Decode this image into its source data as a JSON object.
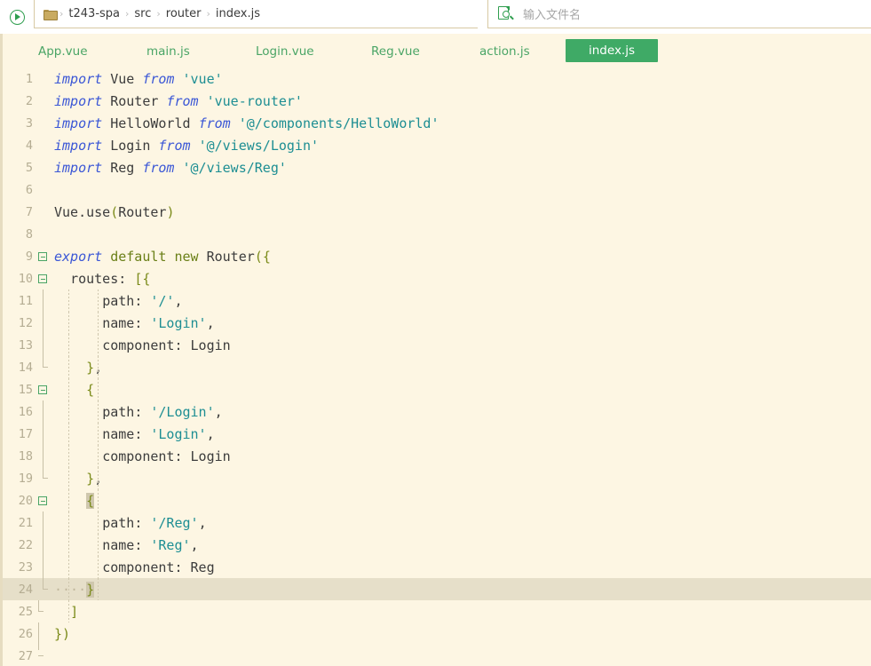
{
  "toolbar": {
    "run_icon": "play-circle-icon",
    "folder_icon": "folder-icon",
    "breadcrumb": [
      "t243-spa",
      "src",
      "router",
      "index.js"
    ],
    "breadcrumb_separator": "›",
    "search": {
      "icon": "find-file-icon",
      "placeholder": "输入文件名"
    }
  },
  "tabs": [
    {
      "label": "App.vue",
      "active": false
    },
    {
      "label": "main.js",
      "active": false
    },
    {
      "label": "Login.vue",
      "active": false
    },
    {
      "label": "Reg.vue",
      "active": false
    },
    {
      "label": "action.js",
      "active": false
    },
    {
      "label": "index.js",
      "active": true
    }
  ],
  "editor": {
    "file": "index.js",
    "current_line": 24,
    "total_lines": 27,
    "colors": {
      "background": "#fdf6e3",
      "current_line": "#e6dfc9",
      "line_number": "#b5ad93",
      "keyword": "#3b57d6",
      "keyword2": "#6a7f17",
      "identifier": "#3c3c3c",
      "string": "#1d8e93",
      "bracket": "#7a8a18",
      "accent_green": "#3faa66"
    },
    "lines": [
      {
        "n": 1,
        "text": "import Vue from 'vue'"
      },
      {
        "n": 2,
        "text": "import Router from 'vue-router'"
      },
      {
        "n": 3,
        "text": "import HelloWorld from '@/components/HelloWorld'"
      },
      {
        "n": 4,
        "text": "import Login from '@/views/Login'"
      },
      {
        "n": 5,
        "text": "import Reg from '@/views/Reg'"
      },
      {
        "n": 6,
        "text": ""
      },
      {
        "n": 7,
        "text": "Vue.use(Router)"
      },
      {
        "n": 8,
        "text": ""
      },
      {
        "n": 9,
        "text": "export default new Router({"
      },
      {
        "n": 10,
        "text": "  routes: [{"
      },
      {
        "n": 11,
        "text": "      path: '/',"
      },
      {
        "n": 12,
        "text": "      name: 'Login',"
      },
      {
        "n": 13,
        "text": "      component: Login"
      },
      {
        "n": 14,
        "text": "    },"
      },
      {
        "n": 15,
        "text": "    {"
      },
      {
        "n": 16,
        "text": "      path: '/Login',"
      },
      {
        "n": 17,
        "text": "      name: 'Login',"
      },
      {
        "n": 18,
        "text": "      component: Login"
      },
      {
        "n": 19,
        "text": "    },"
      },
      {
        "n": 20,
        "text": "    {"
      },
      {
        "n": 21,
        "text": "      path: '/Reg',"
      },
      {
        "n": 22,
        "text": "      name: 'Reg',"
      },
      {
        "n": 23,
        "text": "      component: Reg"
      },
      {
        "n": 24,
        "text": "    }"
      },
      {
        "n": 25,
        "text": "  ]"
      },
      {
        "n": 26,
        "text": "})"
      },
      {
        "n": 27,
        "text": ""
      }
    ]
  }
}
